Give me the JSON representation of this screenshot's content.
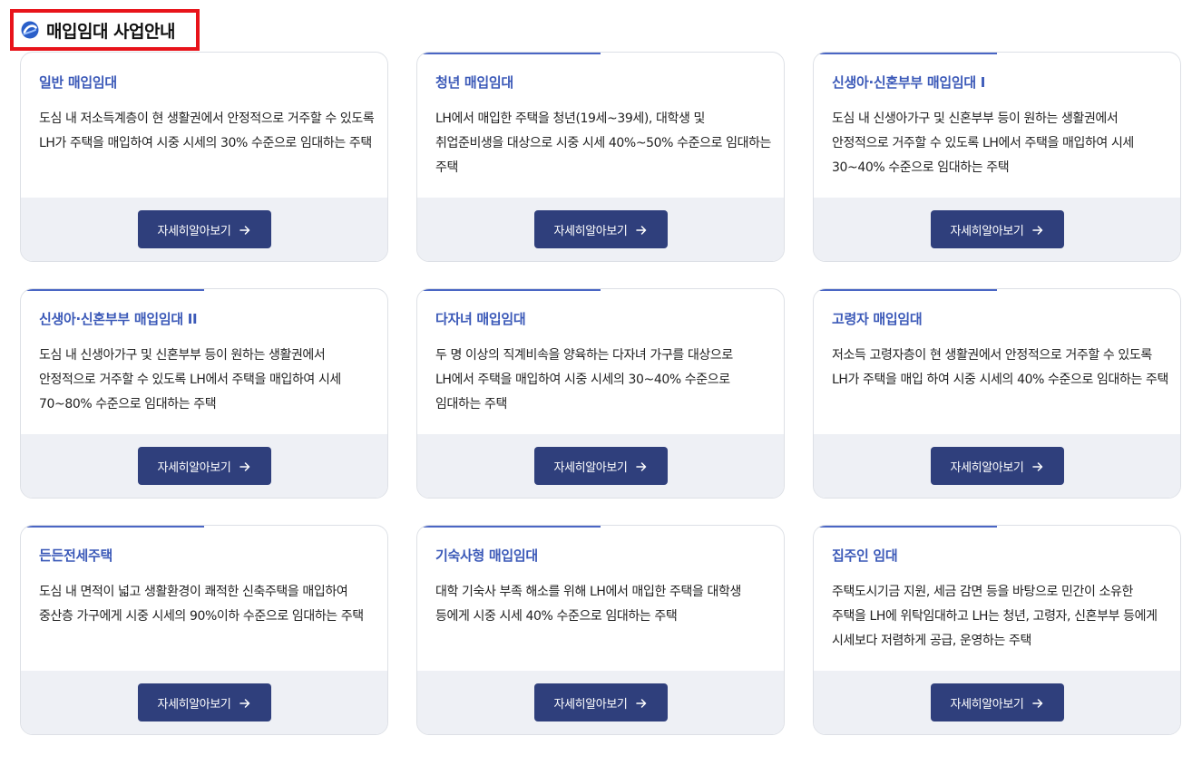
{
  "header": {
    "title": "매입임대 사업안내",
    "icon": "lh-logo-icon"
  },
  "colors": {
    "accent": "#3b59b8",
    "button": "#2f3f7c",
    "highlight_border": "#e8131a",
    "footer_bg": "#eef0f5"
  },
  "cards": [
    {
      "title": "일반 매입임대",
      "description": "도심 내 저소득계층이 현 생활권에서 안정적으로 거주할 수 있도록 LH가 주택을 매입하여 시중 시세의 30% 수준으로 임대하는 주택",
      "button_label": "자세히알아보기"
    },
    {
      "title": "청년 매입임대",
      "description": "LH에서 매입한 주택을 청년(19세~39세), 대학생 및 취업준비생을 대상으로 시중 시세 40%~50% 수준으로 임대하는 주택",
      "button_label": "자세히알아보기"
    },
    {
      "title": "신생아·신혼부부 매입임대 Ⅰ",
      "description": "도심 내 신생아가구 및 신혼부부 등이 원하는 생활권에서 안정적으로 거주할 수 있도록 LH에서 주택을 매입하여 시세 30~40% 수준으로 임대하는 주택",
      "button_label": "자세히알아보기"
    },
    {
      "title": "신생아·신혼부부 매입임대 II",
      "description": "도심 내 신생아가구 및 신혼부부 등이 원하는 생활권에서 안정적으로 거주할 수 있도록 LH에서 주택을 매입하여 시세 70~80% 수준으로 임대하는 주택",
      "button_label": "자세히알아보기"
    },
    {
      "title": "다자녀 매입임대",
      "description": "두 명 이상의 직계비속을 양육하는 다자녀 가구를 대상으로 LH에서 주택을 매입하여 시중 시세의 30~40% 수준으로 임대하는 주택",
      "button_label": "자세히알아보기"
    },
    {
      "title": "고령자 매입임대",
      "description": "저소득 고령자층이 현 생활권에서 안정적으로 거주할 수 있도록 LH가 주택을 매입 하여 시중 시세의 40% 수준으로 임대하는 주택",
      "button_label": "자세히알아보기"
    },
    {
      "title": "든든전세주택",
      "description": "도심 내 면적이 넓고 생활환경이 쾌적한 신축주택을 매입하여 중산층 가구에게 시중 시세의 90%이하 수준으로 임대하는 주택",
      "button_label": "자세히알아보기"
    },
    {
      "title": "기숙사형 매입임대",
      "description": "대학 기숙사 부족 해소를 위해 LH에서 매입한 주택을 대학생 등에게 시중 시세 40% 수준으로 임대하는 주택",
      "button_label": "자세히알아보기"
    },
    {
      "title": "집주인 임대",
      "description": "주택도시기금 지원, 세금 감면 등을 바탕으로 민간이 소유한 주택을 LH에 위탁임대하고 LH는 청년, 고령자, 신혼부부 등에게 시세보다 저렴하게 공급, 운영하는 주택",
      "button_label": "자세히알아보기"
    }
  ]
}
